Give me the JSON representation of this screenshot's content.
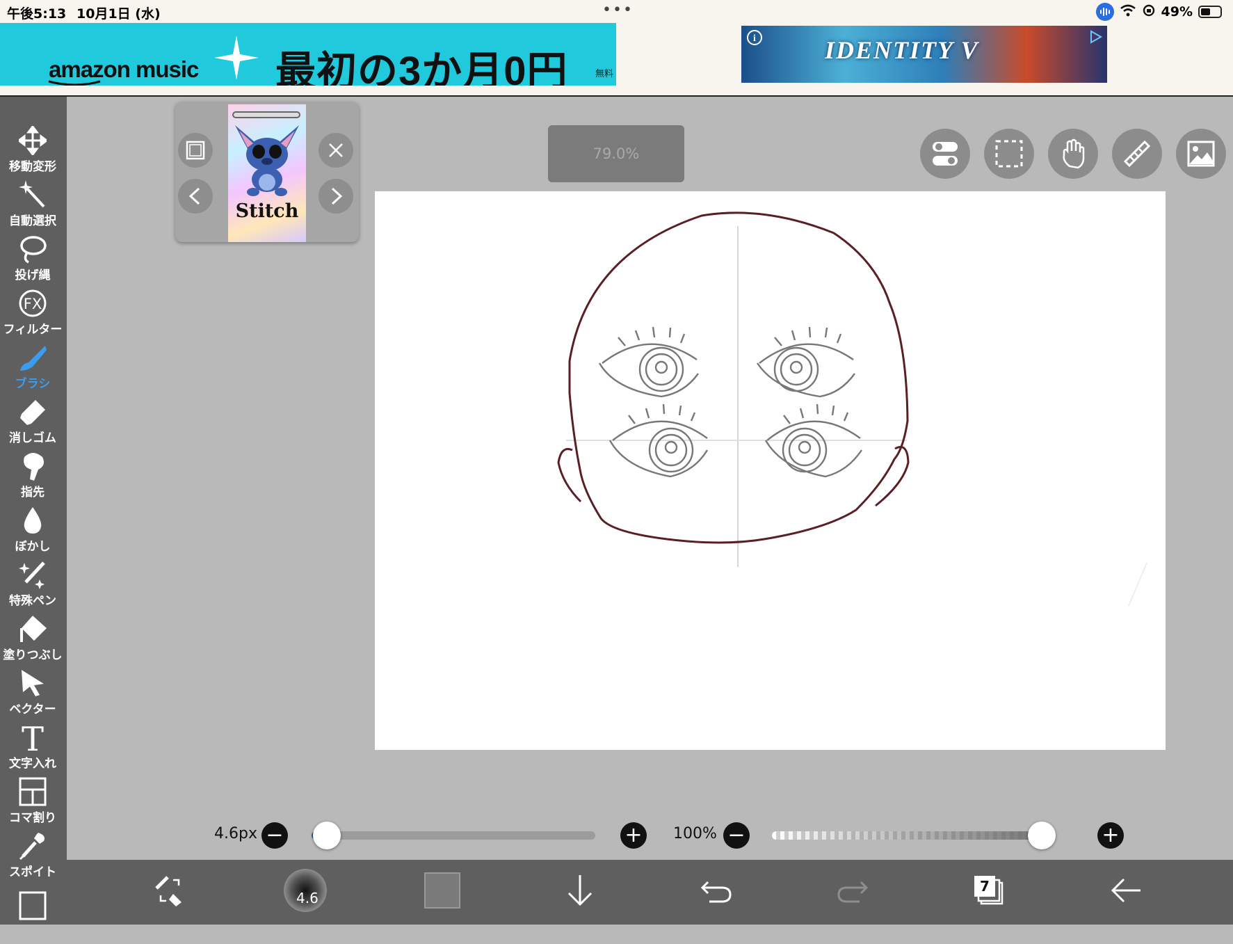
{
  "status_bar": {
    "time": "午後5:13",
    "date": "10月1日 (水)",
    "dots": "•••",
    "battery": "49%",
    "battery_level": 0.49
  },
  "ads": {
    "amazon_brand": "amazon music",
    "amazon_promo": "最初の3か月0円",
    "amazon_fine": "無料",
    "game_title": "IDENTITY V",
    "info_icon": "i"
  },
  "tools": [
    {
      "label": "移動変形",
      "icon": "move-icon"
    },
    {
      "label": "自動選択",
      "icon": "magic-wand-icon"
    },
    {
      "label": "投げ縄",
      "icon": "lasso-icon"
    },
    {
      "label": "フィルター",
      "icon": "fx-icon",
      "glyph": "FX"
    },
    {
      "label": "ブラシ",
      "icon": "brush-icon",
      "active": true
    },
    {
      "label": "消しゴム",
      "icon": "eraser-icon"
    },
    {
      "label": "指先",
      "icon": "finger-icon"
    },
    {
      "label": "ぼかし",
      "icon": "blur-drop-icon"
    },
    {
      "label": "特殊ペン",
      "icon": "special-pen-icon"
    },
    {
      "label": "塗りつぶし",
      "icon": "fill-bucket-icon"
    },
    {
      "label": "ベクター",
      "icon": "vector-arrow-icon"
    },
    {
      "label": "文字入れ",
      "icon": "text-icon",
      "glyph": "T"
    },
    {
      "label": "コマ割り",
      "icon": "frame-divide-icon"
    },
    {
      "label": "スポイト",
      "icon": "eyedropper-icon"
    }
  ],
  "material_panel": {
    "thumbnail_label": "Stitch"
  },
  "zoom": "79.0%",
  "brush": {
    "size_label": "4.6px",
    "size_badge": "4.6",
    "opacity_label": "100%",
    "size_fraction": 0.04,
    "opacity_fraction": 1.0
  },
  "layers": {
    "count": "7"
  },
  "colors": {
    "accent": "#3b9df0",
    "toolbar_bg": "#5f5f5f",
    "workspace_bg": "#b9b9b9",
    "current_color": "#7a7a7a",
    "line_color": "#5a1f24"
  }
}
